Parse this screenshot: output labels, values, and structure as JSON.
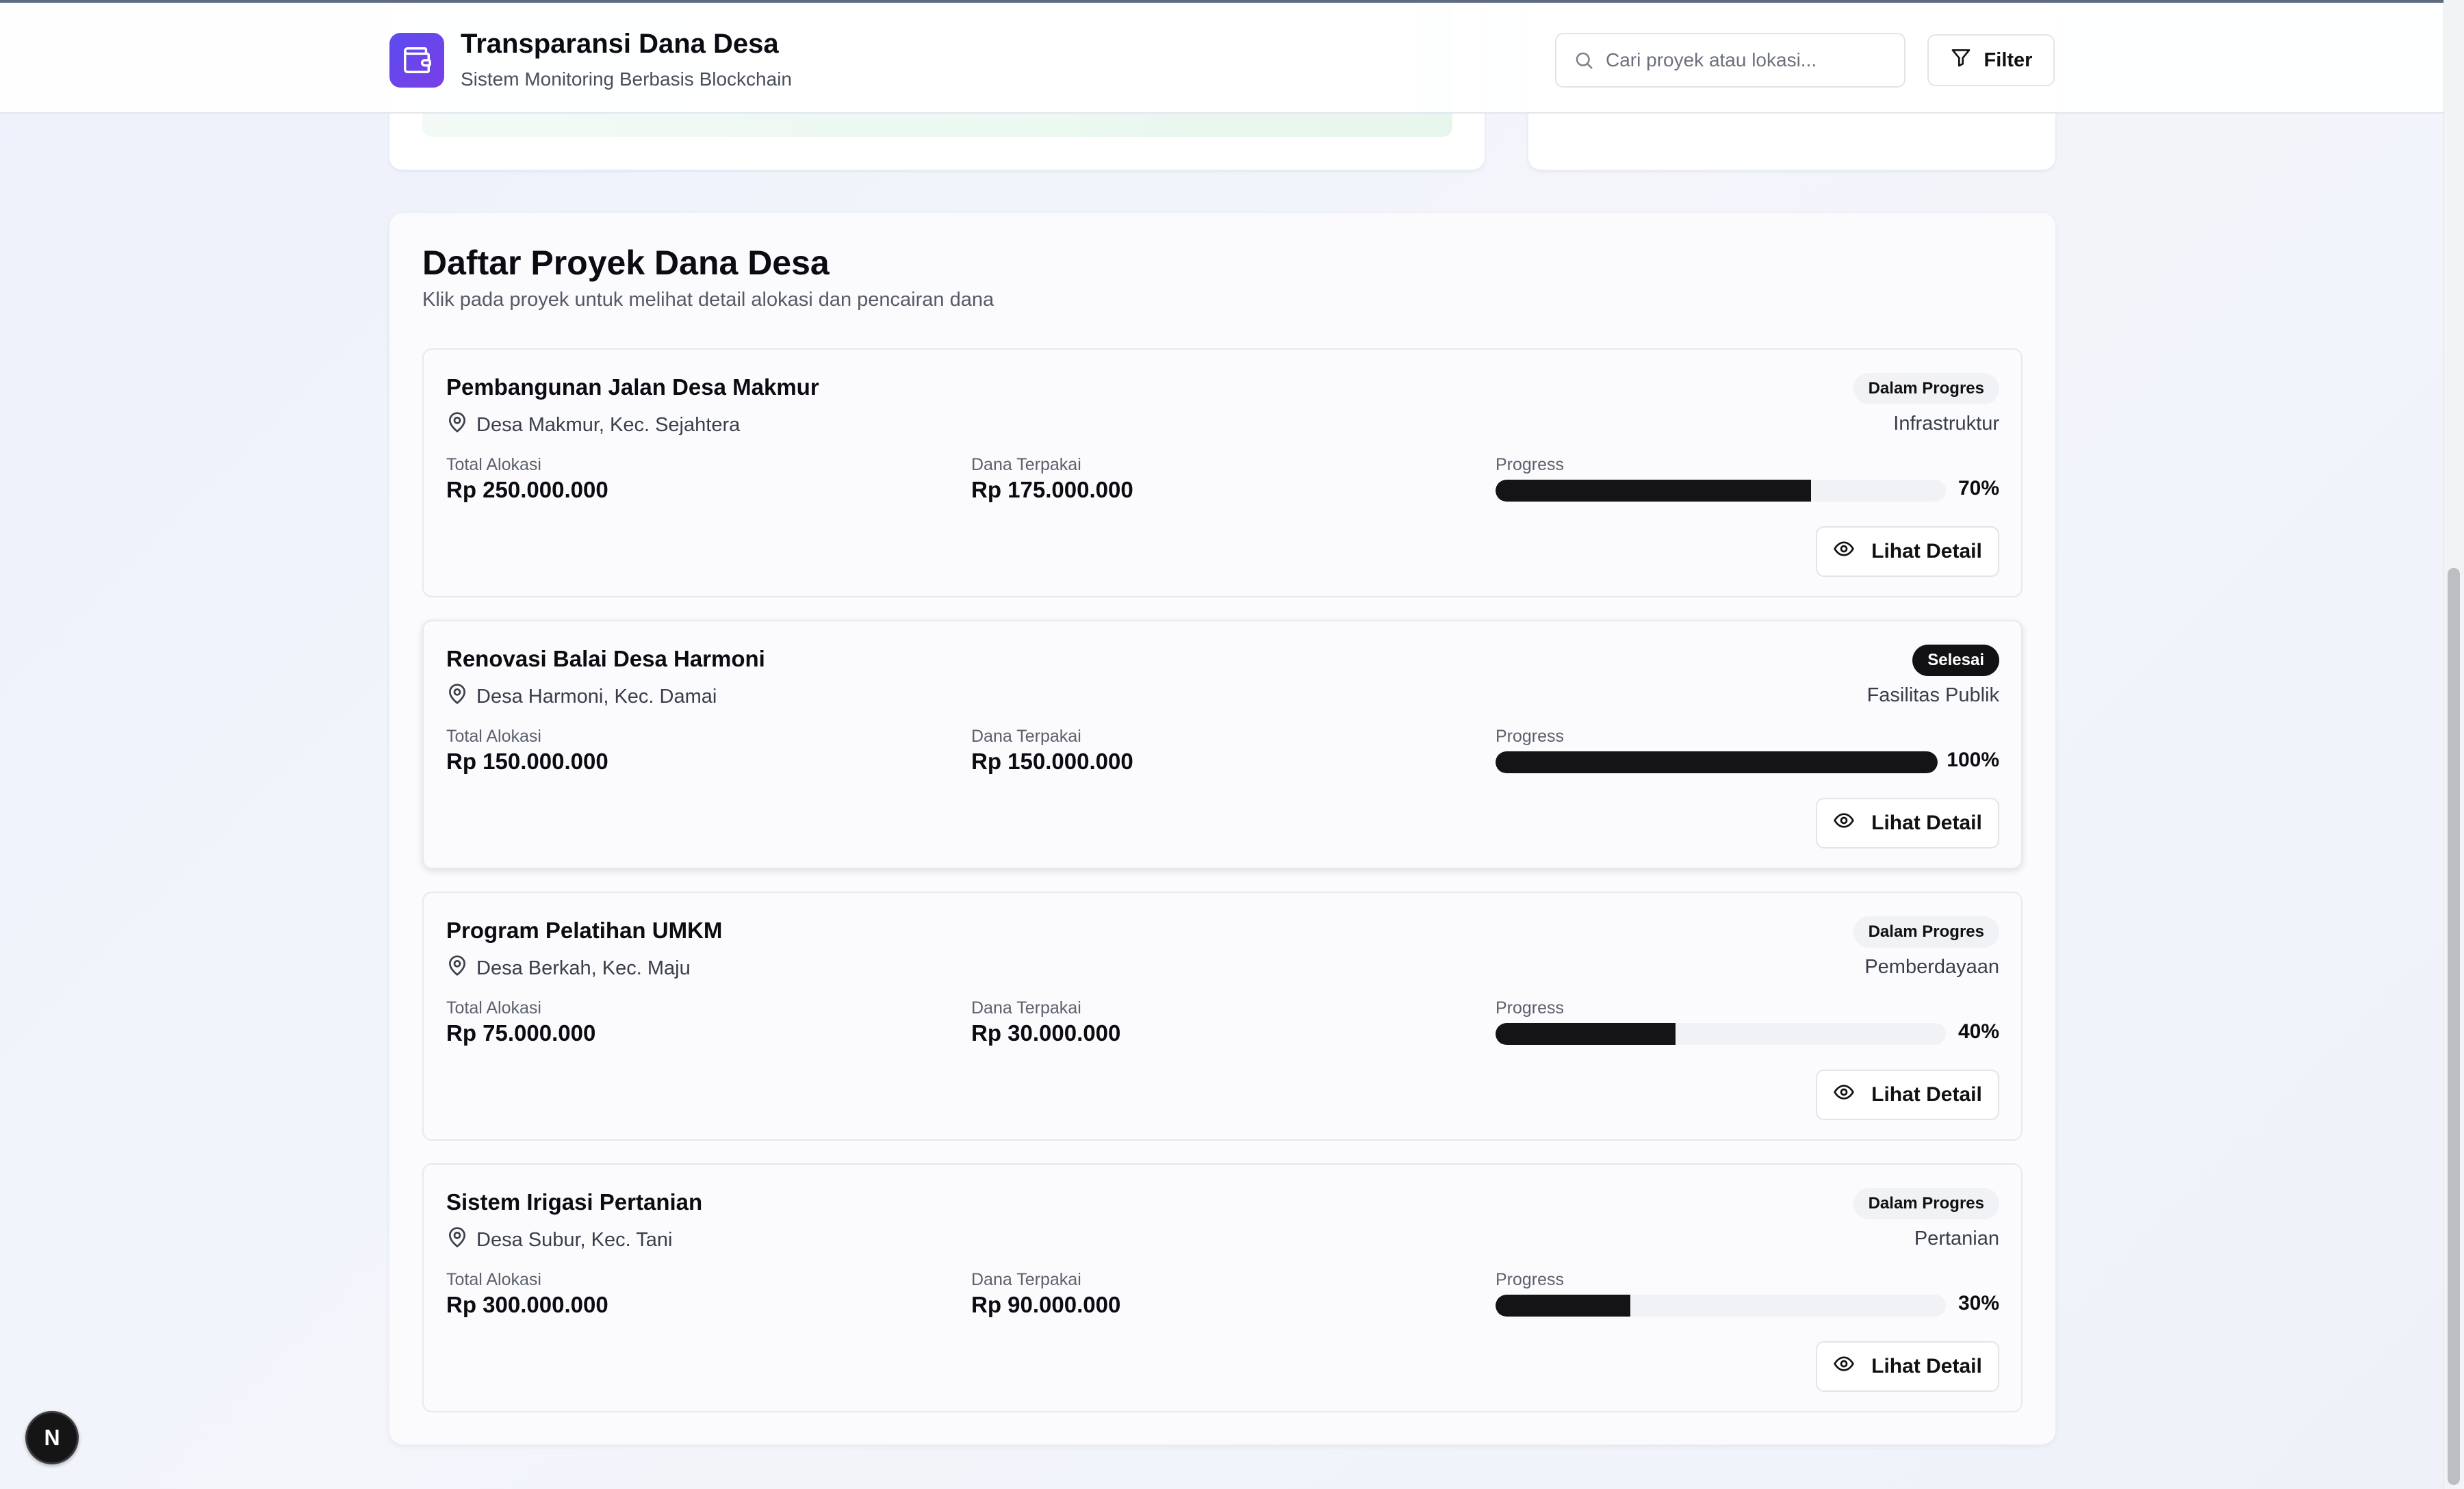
{
  "header": {
    "title": "Transparansi Dana Desa",
    "subtitle": "Sistem Monitoring Berbasis Blockchain",
    "search_placeholder": "Cari proyek atau lokasi...",
    "filter_label": "Filter",
    "logo_icon": "wallet-icon"
  },
  "projects_section": {
    "title": "Daftar Proyek Dana Desa",
    "description": "Klik pada proyek untuk melihat detail alokasi dan pencairan dana",
    "labels": {
      "total": "Total Alokasi",
      "spent": "Dana Terpakai",
      "progress": "Progress",
      "detail_button": "Lihat Detail"
    },
    "projects": [
      {
        "name": "Pembangunan Jalan Desa Makmur",
        "location": "Desa Makmur, Kec. Sejahtera",
        "status": "Dalam Progres",
        "category": "Infrastruktur",
        "total": "Rp 250.000.000",
        "spent": "Rp 175.000.000",
        "progress": 70,
        "progress_label": "70%"
      },
      {
        "name": "Renovasi Balai Desa Harmoni",
        "location": "Desa Harmoni, Kec. Damai",
        "status": "Selesai",
        "category": "Fasilitas Publik",
        "total": "Rp 150.000.000",
        "spent": "Rp 150.000.000",
        "progress": 100,
        "progress_label": "100%"
      },
      {
        "name": "Program Pelatihan UMKM",
        "location": "Desa Berkah, Kec. Maju",
        "status": "Dalam Progres",
        "category": "Pemberdayaan",
        "total": "Rp 75.000.000",
        "spent": "Rp 30.000.000",
        "progress": 40,
        "progress_label": "40%"
      },
      {
        "name": "Sistem Irigasi Pertanian",
        "location": "Desa Subur, Kec. Tani",
        "status": "Dalam Progres",
        "category": "Pertanian",
        "total": "Rp 300.000.000",
        "spent": "Rp 90.000.000",
        "progress": 30,
        "progress_label": "30%"
      }
    ]
  },
  "dev_badge": {
    "label": "N"
  },
  "colors": {
    "accent": "#5b4cf0",
    "bar_fill": "#141416",
    "bar_track": "#f1f2f5",
    "status_done": "#121214"
  }
}
